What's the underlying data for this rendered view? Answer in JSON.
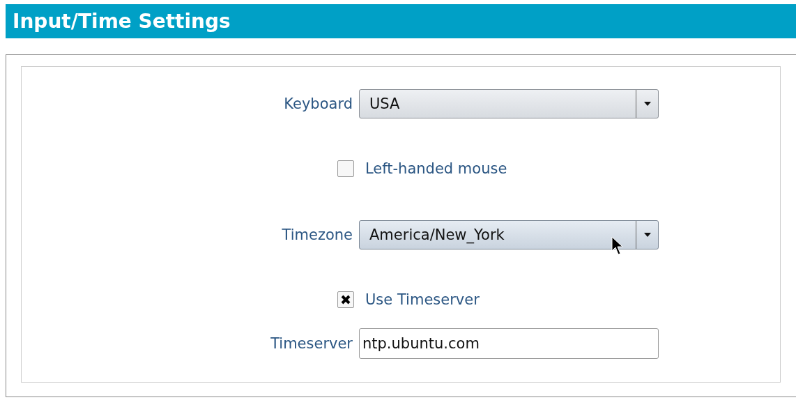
{
  "title": "Input/Time Settings",
  "keyboard": {
    "label": "Keyboard",
    "value": "USA",
    "hovered": false
  },
  "left_handed_mouse": {
    "label": "Left-handed mouse",
    "checked": false
  },
  "timezone": {
    "label": "Timezone",
    "value": "America/New_York",
    "hovered": true
  },
  "use_timeserver": {
    "label": "Use Timeserver",
    "checked": true
  },
  "timeserver": {
    "label": "Timeserver",
    "value": "ntp.ubuntu.com"
  }
}
